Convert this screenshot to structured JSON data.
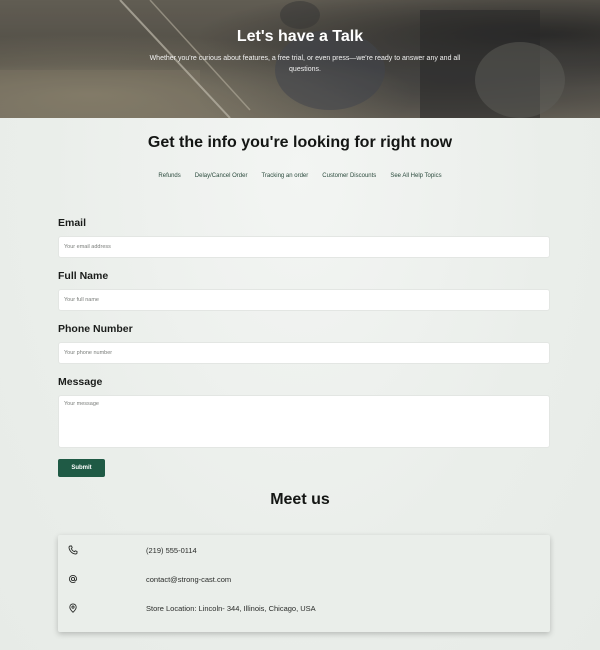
{
  "hero": {
    "title": "Let's have a Talk",
    "subtitle": "Whether you're curious about features, a free trial, or even press—we're ready to answer any and all questions."
  },
  "info": {
    "title": "Get the info you're looking for right now",
    "topics": [
      "Refunds",
      "Delay/Cancel Order",
      "Tracking an order",
      "Customer Discounts",
      "See All Help Topics"
    ]
  },
  "form": {
    "email": {
      "label": "Email",
      "placeholder": "Your email address"
    },
    "full_name": {
      "label": "Full Name",
      "placeholder": "Your full name"
    },
    "phone": {
      "label": "Phone Number",
      "placeholder": "Your phone number"
    },
    "message": {
      "label": "Message",
      "placeholder": "Your message"
    },
    "submit_label": "Submit"
  },
  "meet": {
    "title": "Meet us",
    "contacts": [
      {
        "icon": "phone-icon",
        "text": "(219) 555-0114"
      },
      {
        "icon": "at-icon",
        "text": "contact@strong-cast.com"
      },
      {
        "icon": "location-pin-icon",
        "text": "Store Location: Lincoln- 344, Illinois, Chicago, USA"
      }
    ]
  },
  "colors": {
    "accent": "#1f5a45",
    "page_background": "#eef1ee",
    "link": "#2a4a3c"
  }
}
